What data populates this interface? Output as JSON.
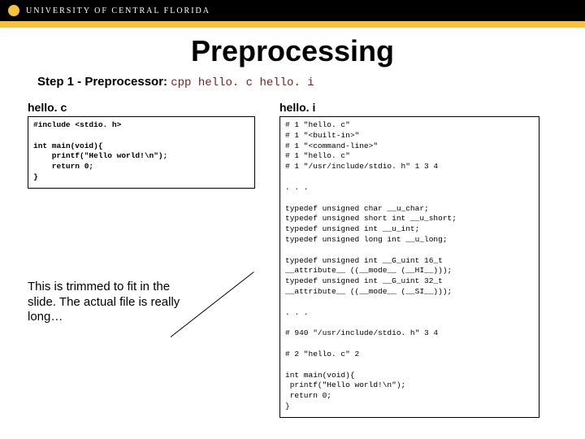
{
  "university": "UNIVERSITY OF CENTRAL FLORIDA",
  "title": "Preprocessing",
  "step": {
    "label": "Step 1 - Preprocessor:",
    "cmd": "cpp hello. c hello. i"
  },
  "left": {
    "filename": "hello. c",
    "line1": "#include <stdio. h>",
    "line2": "int main(void){",
    "line3": "    printf(\"Hello world!\\n\");",
    "line4": "    return 0;",
    "line5": "}"
  },
  "note": "This is trimmed to fit in the slide. The actual file is really long…",
  "right": {
    "filename": "hello. i",
    "b1l1": "# 1 \"hello. c\"",
    "b1l2": "# 1 \"<built-in>\"",
    "b1l3": "# 1 \"<command-line>\"",
    "b1l4": "# 1 \"hello. c\"",
    "b1l5": "# 1 \"/usr/include/stdio. h\" 1 3 4",
    "dots1": ". . .",
    "b2l1": "typedef unsigned char __u_char;",
    "b2l2": "typedef unsigned short int __u_short;",
    "b2l3": "typedef unsigned int __u_int;",
    "b2l4": "typedef unsigned long int __u_long;",
    "b3l1": "typedef unsigned int __G_uint 16_t",
    "b3l2": "__attribute__ ((__mode__ (__HI__)));",
    "b3l3": "typedef unsigned int __G_uint 32_t",
    "b3l4": "__attribute__ ((__mode__ (__SI__)));",
    "dots2": ". . .",
    "b4l1": "# 940 \"/usr/include/stdio. h\" 3 4",
    "b5l1": "# 2 \"hello. c\" 2",
    "b6l1": "int main(void){",
    "b6l2": " printf(\"Hello world!\\n\");",
    "b6l3": " return 0;",
    "b6l4": "}"
  }
}
